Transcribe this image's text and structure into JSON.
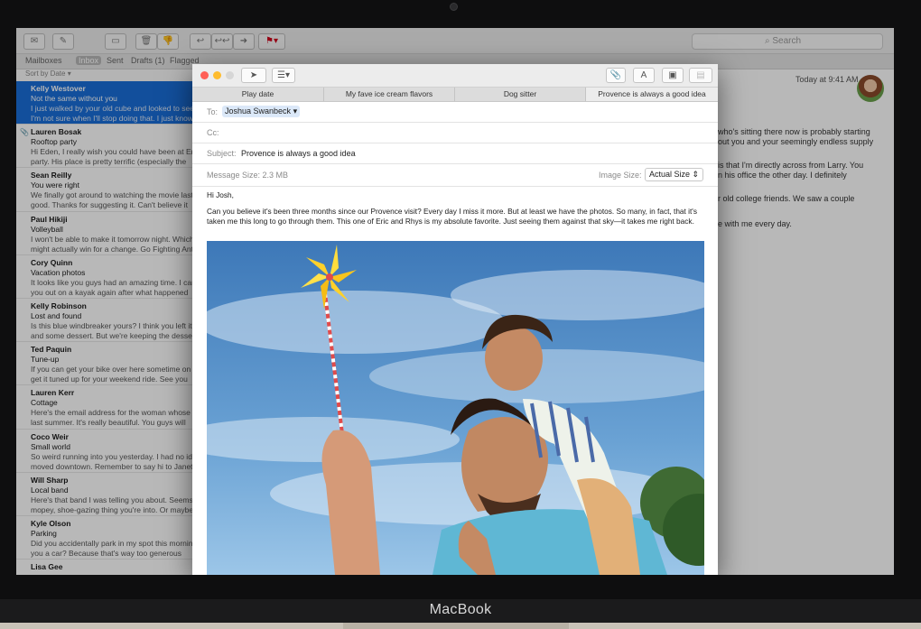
{
  "device": {
    "brand": "MacBook"
  },
  "mail": {
    "search_placeholder": "Search",
    "favorites": [
      "Mailboxes",
      "Inbox",
      "Sent",
      "Drafts (1)",
      "Flagged"
    ],
    "sort_label": "Sort by Date ▾",
    "messages": [
      {
        "from": "Kelly Westover",
        "subject": "Not the same without you",
        "preview1": "I just walked by your old cube and looked to see",
        "preview2": "I'm not sure when I'll stop doing that. I just know",
        "selected": true
      },
      {
        "from": "Lauren Bosak",
        "subject": "Rooftop party",
        "preview1": "Hi Eden, I really wish you could have been at Eric's",
        "preview2": "party. His place is pretty terrific (especially the",
        "attachment": true
      },
      {
        "from": "Sean Reilly",
        "subject": "You were right",
        "preview1": "We finally got around to watching the movie last night.",
        "preview2": "good. Thanks for suggesting it. Can't believe it"
      },
      {
        "from": "Paul Hikiji",
        "subject": "Volleyball",
        "preview1": "I won't be able to make it tomorrow night. Which",
        "preview2": "might actually win for a change. Go Fighting Ants!"
      },
      {
        "from": "Cory Quinn",
        "subject": "Vacation photos",
        "preview1": "It looks like you guys had an amazing time. I can't",
        "preview2": "you out on a kayak again after what happened"
      },
      {
        "from": "Kelly Robinson",
        "subject": "Lost and found",
        "preview1": "Is this blue windbreaker yours? I think you left it",
        "preview2": "and some dessert. But we're keeping the dessert."
      },
      {
        "from": "Ted Paquin",
        "subject": "Tune-up",
        "preview1": "If you can get your bike over here sometime on",
        "preview2": "get it tuned up for your weekend ride. See you"
      },
      {
        "from": "Lauren Kerr",
        "subject": "Cottage",
        "preview1": "Here's the email address for the woman whose",
        "preview2": "last summer. It's really beautiful. You guys will"
      },
      {
        "from": "Coco Weir",
        "subject": "Small world",
        "preview1": "So weird running into you yesterday. I had no idea you",
        "preview2": "moved downtown. Remember to say hi to Janet"
      },
      {
        "from": "Will Sharp",
        "subject": "Local band",
        "preview1": "Here's that band I was telling you about. Seems",
        "preview2": "mopey, shoe-gazing thing you're into. Or maybe"
      },
      {
        "from": "Kyle Olson",
        "subject": "Parking",
        "preview1": "Did you accidentally park in my spot this morning?",
        "preview2": "you a car? Because that's way too generous"
      },
      {
        "from": "Lisa Gee",
        "subject": "",
        "preview1": "",
        "preview2": ""
      }
    ],
    "reader": {
      "date": "Today at 9:41 AM",
      "lines": [
        "who's sitting there now is probably starting",
        "out you and your seemingly endless supply",
        "",
        "is that I'm directly across from Larry. You",
        "n his office the other day. I definitely",
        "",
        "r old college friends. We saw a couple",
        "",
        "e with me every day."
      ]
    }
  },
  "compose": {
    "tabs": [
      "Play date",
      "My fave ice cream flavors",
      "Dog sitter",
      "Provence is always a good idea"
    ],
    "active_tab": 3,
    "to_label": "To:",
    "to_value": "Joshua Swanbeck",
    "cc_label": "Cc:",
    "subject_label": "Subject:",
    "subject_value": "Provence is always a good idea",
    "message_size": "Message Size: 2.3 MB",
    "image_size_label": "Image Size:",
    "image_size_value": "Actual Size",
    "greeting": "Hi Josh,",
    "body_line1": "Can you believe it's been three months since our Provence visit? Every day I miss it more. But at least we have the photos. So many, in fact, that it's",
    "body_line2": "taken me this long to go through them. This one of Eric and Rhys is my absolute favorite. Just seeing them against that sky—it takes me right back."
  },
  "colors": {
    "selection": "#1a6ed8",
    "close": "#ff5f57",
    "minimize": "#febc2e",
    "flag": "#d0021b"
  }
}
